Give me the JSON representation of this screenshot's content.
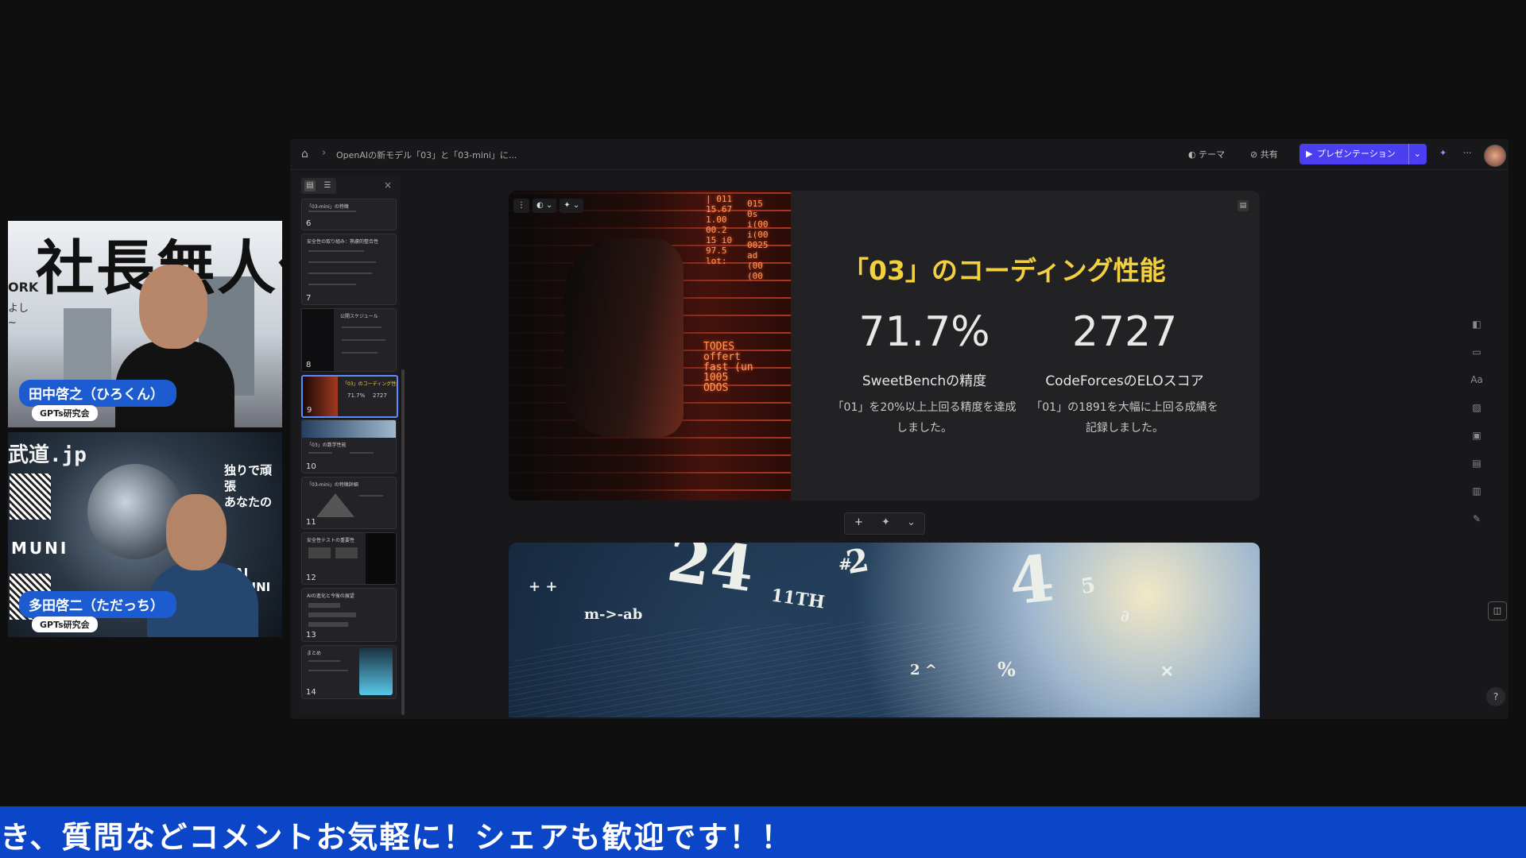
{
  "presenters": [
    {
      "name": "田中啓之（ひろくん）",
      "affiliation": "GPTs研究会",
      "poster_text": "社長無人化",
      "poster_york": "ORK",
      "poster_side": [
        "よし",
        "~"
      ]
    },
    {
      "name": "多田啓二（ただっち）",
      "affiliation": "GPTs研究会",
      "poster_top": "武道.jp",
      "poster_muni": "MUNI",
      "poster_right1": "独りで頑張",
      "poster_right2": "あなたの",
      "poster_ai": "AI MUNI"
    }
  ],
  "app": {
    "breadcrumb": "OpenAIの新モデル「03」と「03-mini」に...",
    "toolbar": {
      "theme": "テーマ",
      "share": "共有",
      "present": "プレゼンテーション"
    },
    "sidebar": {
      "thumbnails": [
        {
          "num": "6",
          "title": "「03-mini」の特徴"
        },
        {
          "num": "7",
          "title": "安全性の取り組み：熟慮的整合性"
        },
        {
          "num": "8",
          "title": "公開スケジュール"
        },
        {
          "num": "9",
          "title": "「03」のコーディング性能"
        },
        {
          "num": "10",
          "title": "「03」の数学性能"
        },
        {
          "num": "11",
          "title": "「03-mini」の特徴詳細"
        },
        {
          "num": "12",
          "title": "安全性テストの重要性"
        },
        {
          "num": "13",
          "title": "AIの進化と今後の展望"
        },
        {
          "num": "14",
          "title": "まとめ"
        }
      ]
    },
    "slide": {
      "title": "「03」のコーディング性能",
      "stats": [
        {
          "value": "71.7%",
          "label": "SweetBenchの精度",
          "desc": "「01」を20%以上上回る精度を達成しました。"
        },
        {
          "value": "2727",
          "label": "CodeForcesのELOスコア",
          "desc": "「01」の1891を大幅に上回る成績を記録しました。"
        }
      ],
      "image_code": [
        "| 011",
        "15.67",
        "00.2",
        "TODES",
        "offert",
        "ODOS",
        "1005",
        "lot:"
      ]
    },
    "slide2": {
      "math": [
        "24",
        "11TH",
        "m->-ab",
        "+ +",
        "4",
        "%",
        "2",
        "#"
      ]
    },
    "icons": {
      "home": "home-icon",
      "theme": "palette-icon",
      "share": "link-icon",
      "present": "play-icon"
    }
  },
  "ticker": "き、質問などコメントお気軽に！シェアも歓迎です！！",
  "colors": {
    "accent": "#4b3df0",
    "title": "#f2d03f",
    "ticker": "#0b45c8",
    "namepill": "#1d5cd0"
  }
}
